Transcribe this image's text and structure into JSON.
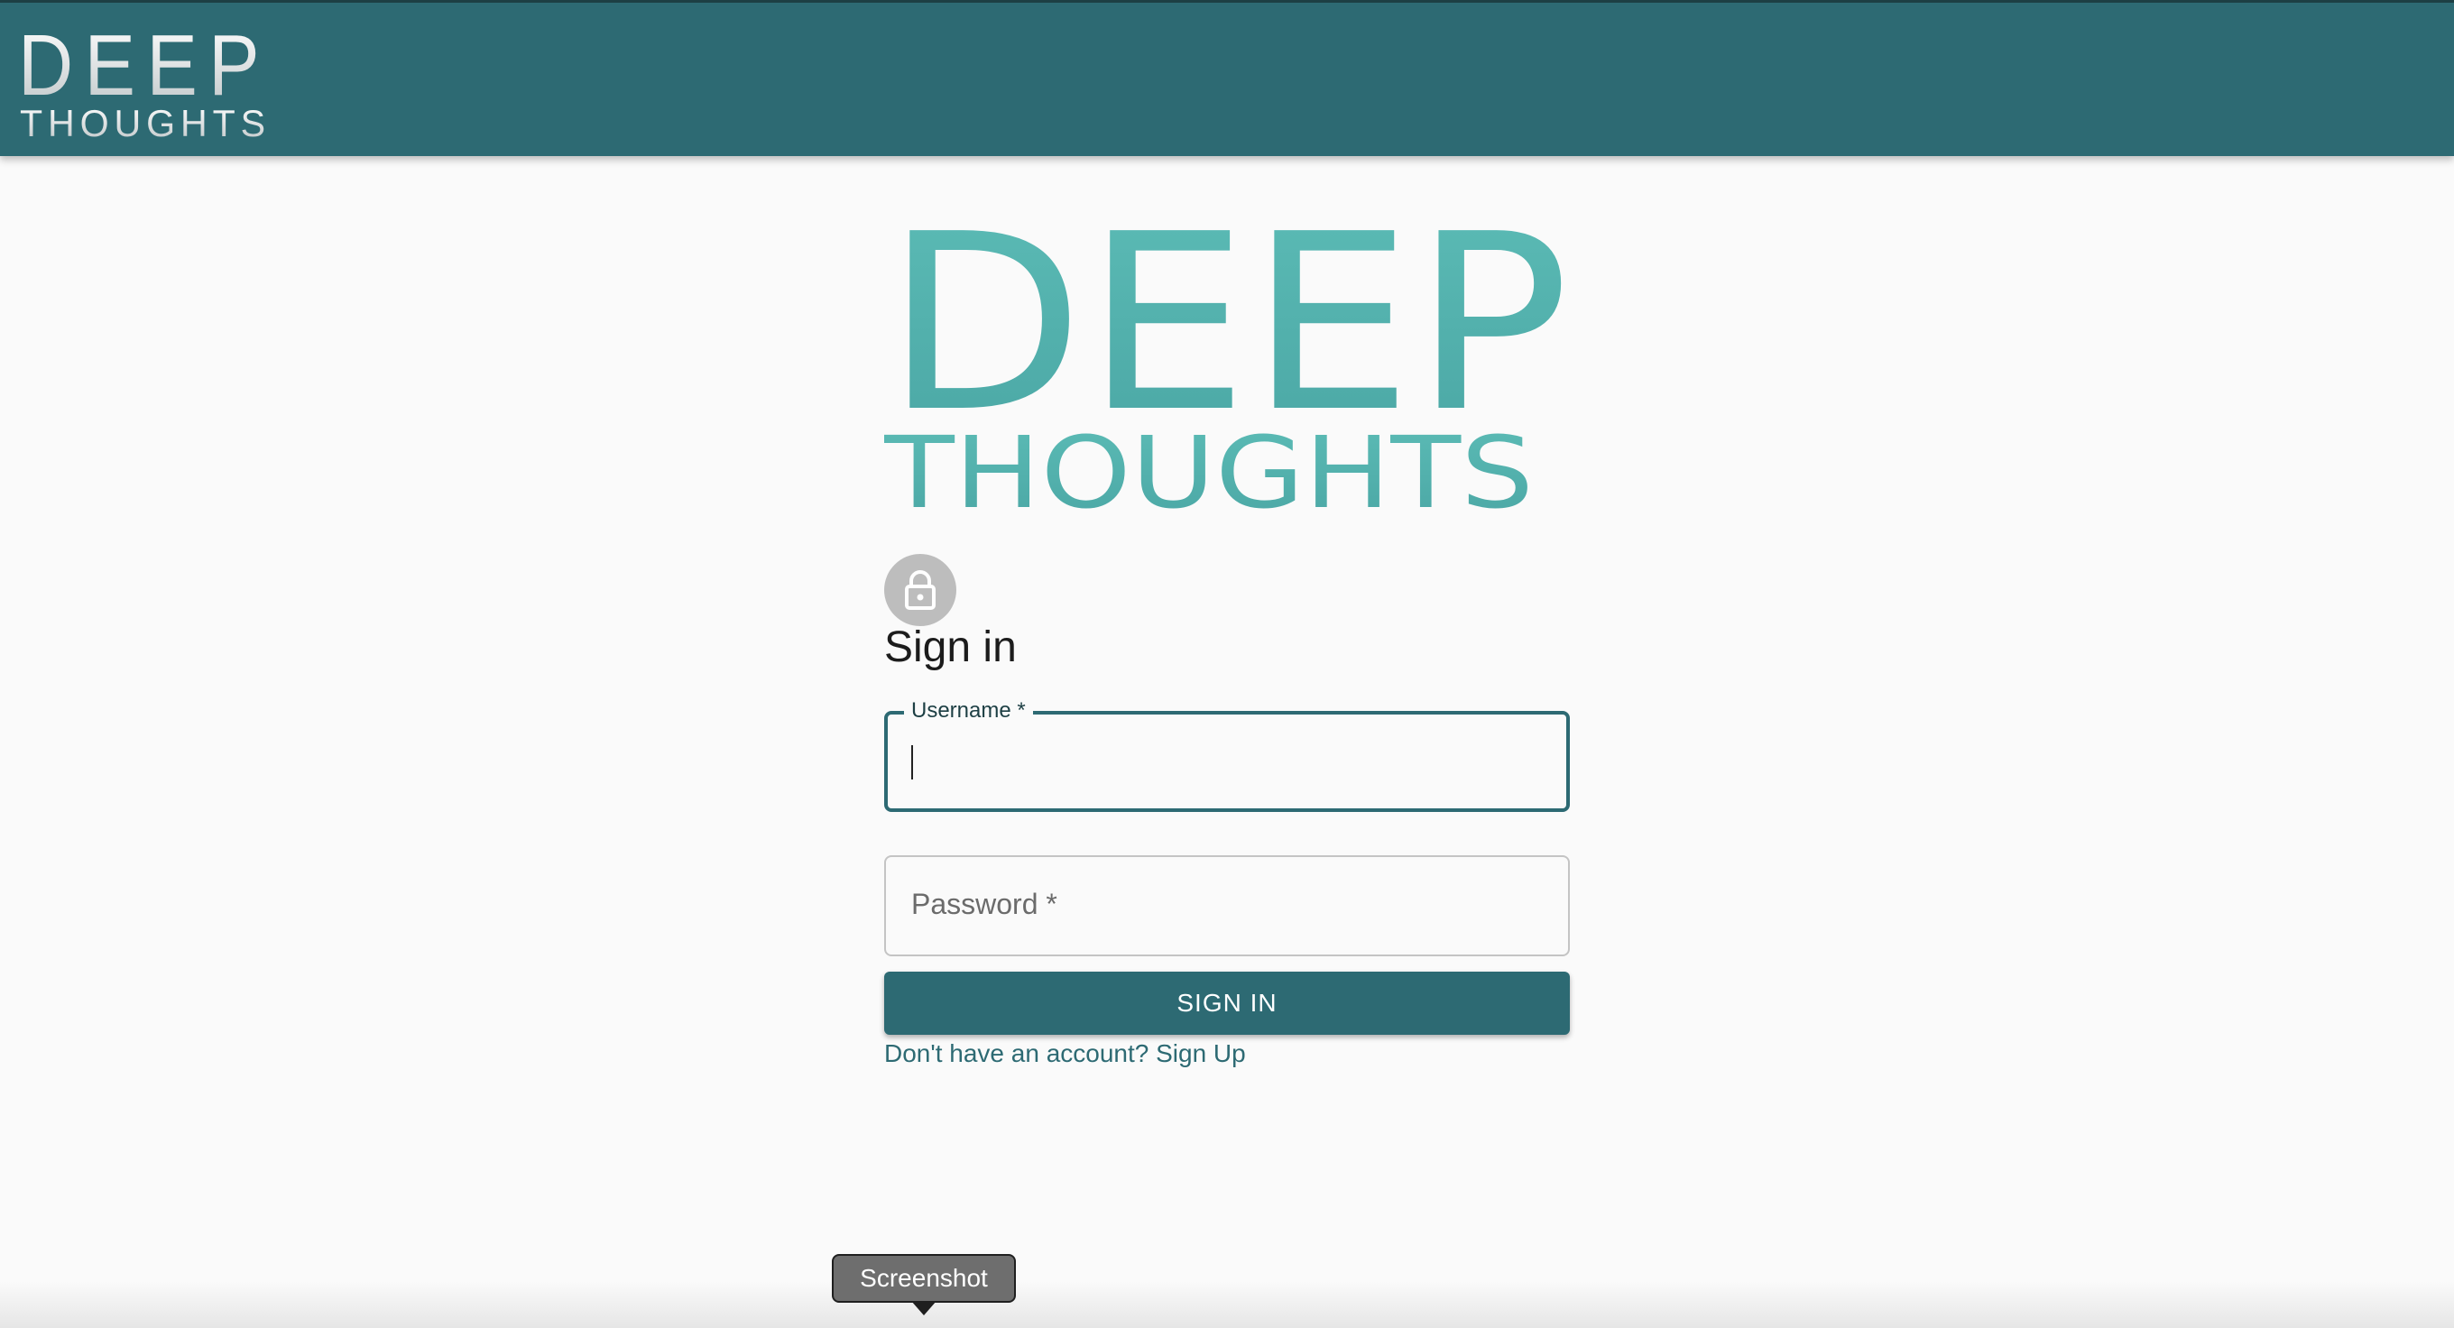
{
  "header": {
    "logo_line1": "DEEP",
    "logo_line2": "THOUGHTS"
  },
  "hero": {
    "logo_line1": "DEEP",
    "logo_line2": "THOUGHTS"
  },
  "form": {
    "icon": "lock-icon",
    "title": "Sign in",
    "username_label": "Username *",
    "username_value": "",
    "password_label": "Password *",
    "password_value": "",
    "submit_label": "SIGN IN",
    "signup_link": "Don't have an account? Sign Up"
  },
  "tooltip": {
    "label": "Screenshot"
  },
  "colors": {
    "primary": "#2d6a73",
    "logo_teal": "#58b8b3",
    "background": "#fafafa",
    "avatar": "#bdbdbd"
  }
}
